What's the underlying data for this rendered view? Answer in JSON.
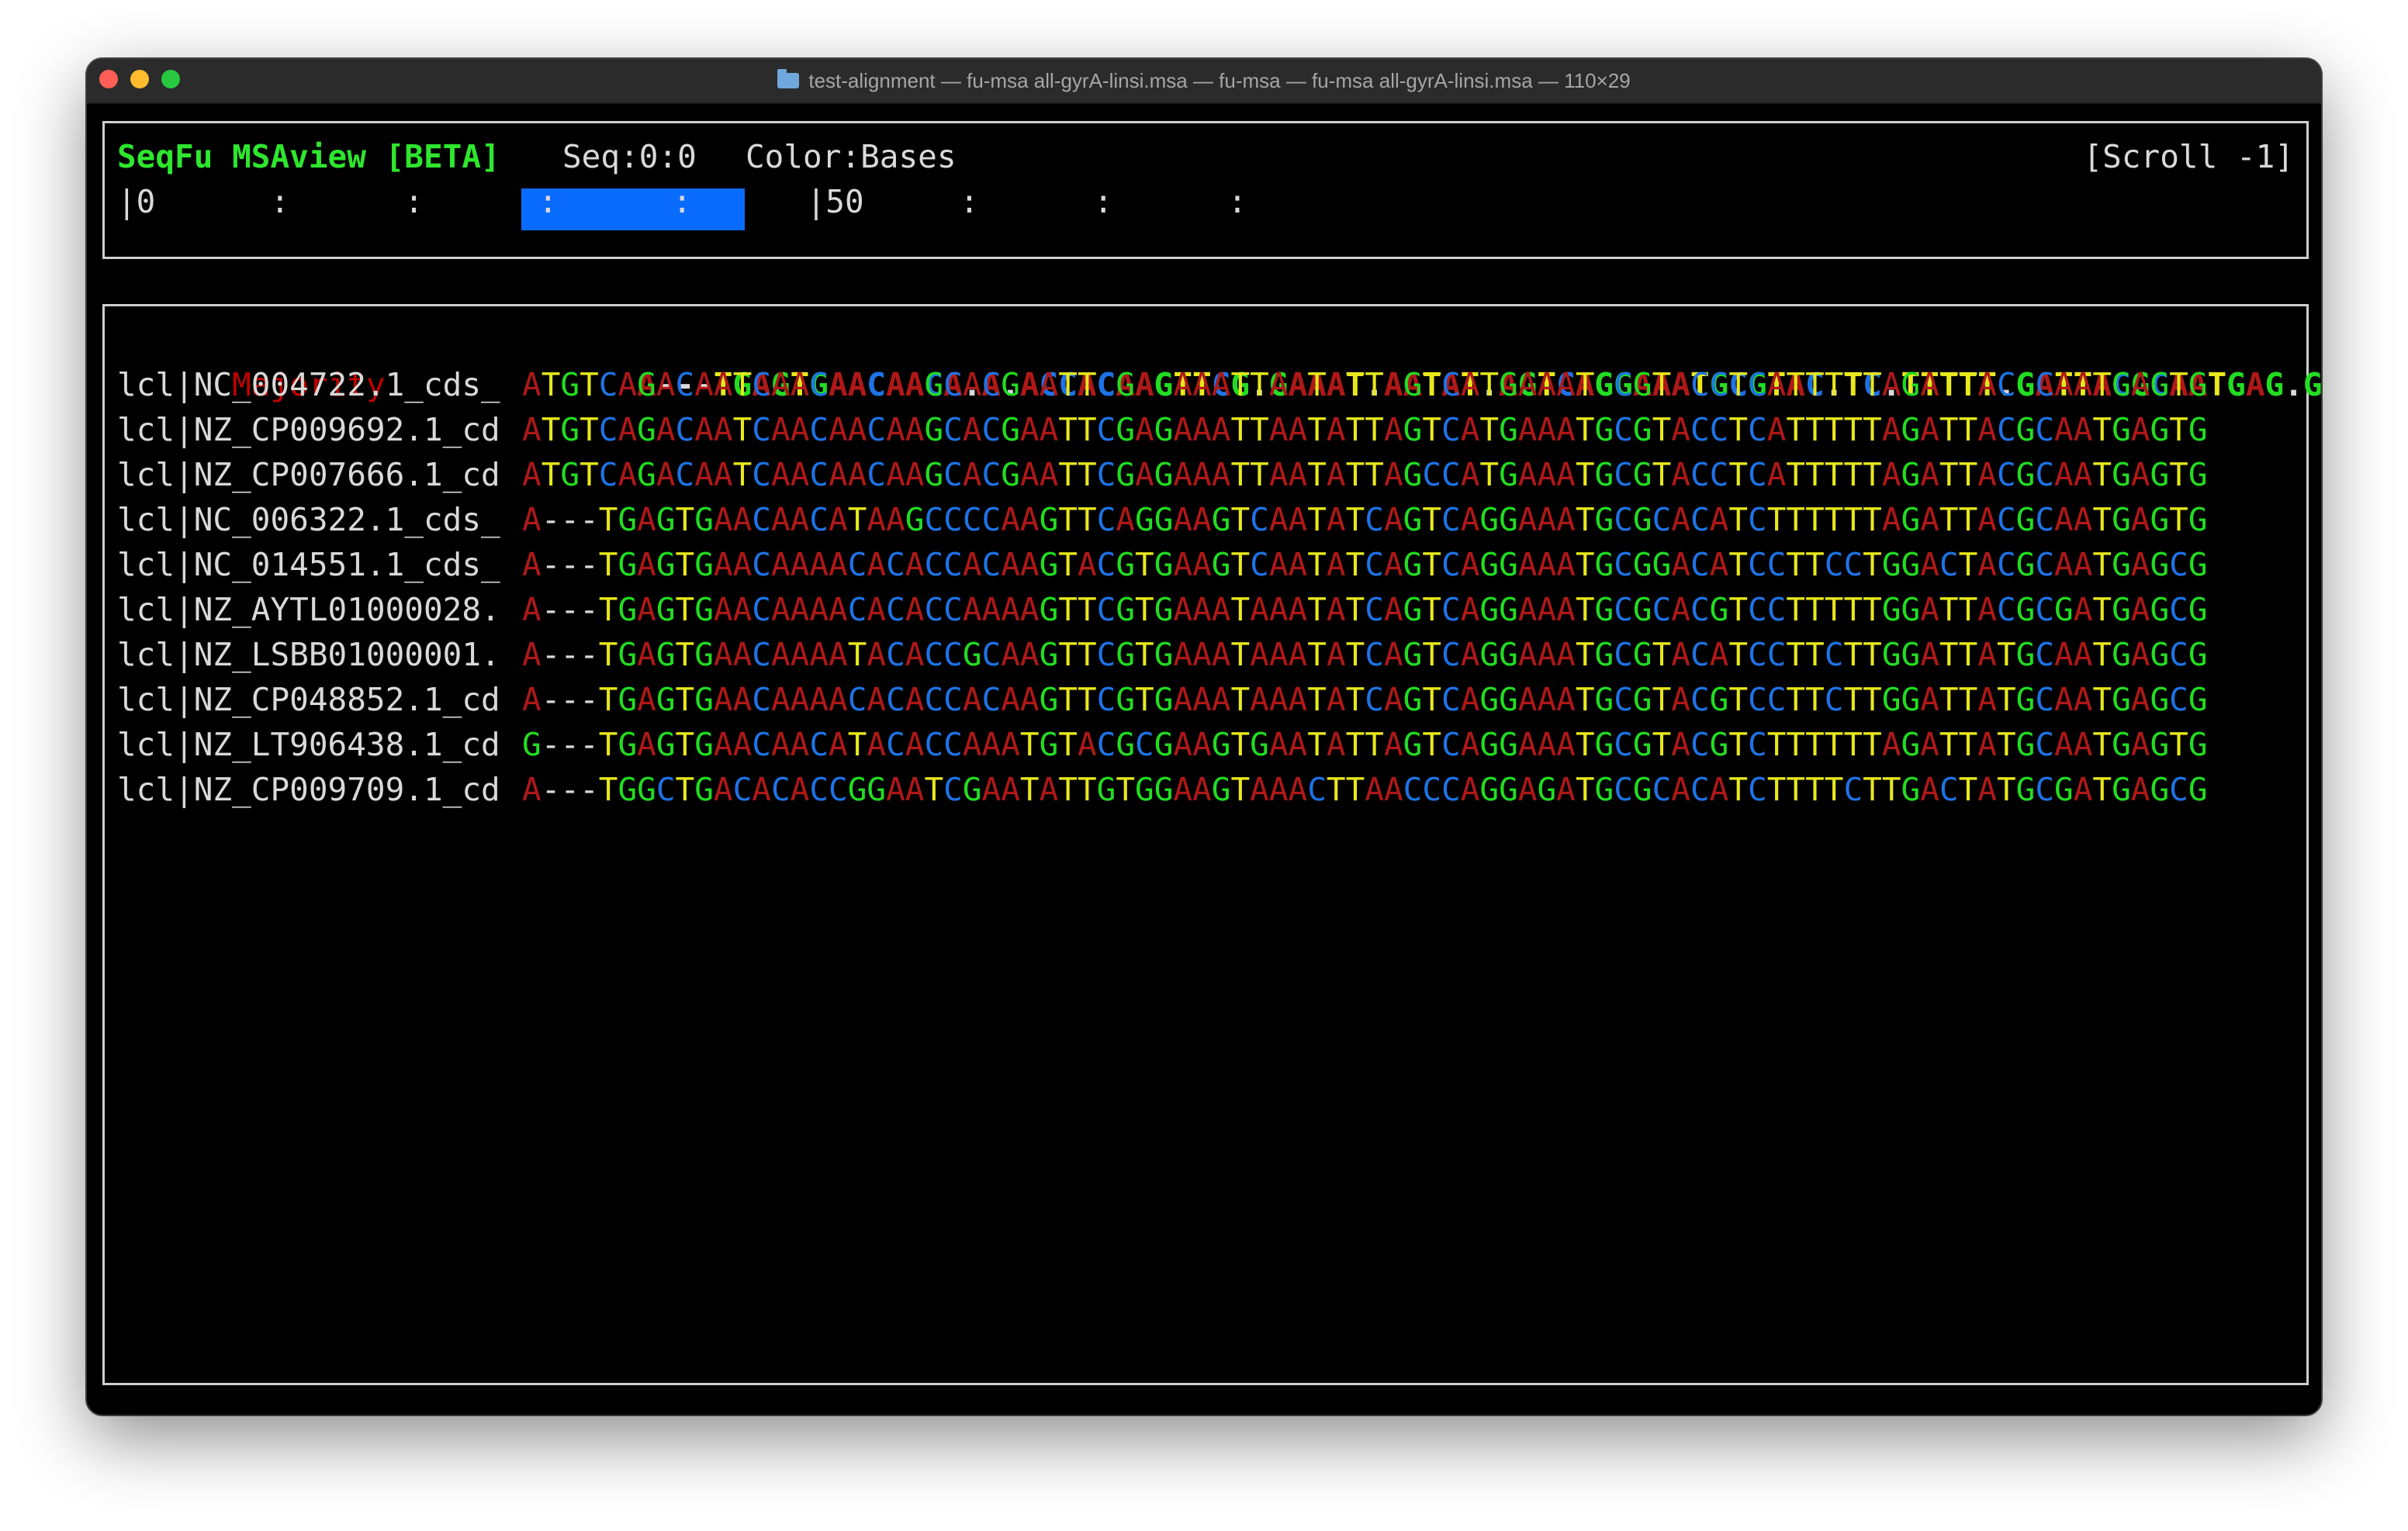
{
  "window": {
    "title": "test-alignment — fu-msa all-gyrA-linsi.msa — fu-msa — fu-msa all-gyrA-linsi.msa — 110×29"
  },
  "header": {
    "app_title": "SeqFu MSAview [BETA]",
    "seq_status": "Seq:0:0",
    "color_status": "Color:Bases",
    "scroll_status": "[Scroll -1]",
    "ruler_text": "|0      :      :      :      :      |50     :      :      :      ",
    "ruler_highlight_columns": 11
  },
  "colors": {
    "A": "#b01818",
    "C": "#1e73e6",
    "G": "#22dd22",
    "T": "#e8e81c",
    "gap": "#d9d9d9",
    "majority_label": "#c00000",
    "app_title": "#2ee62e",
    "ruler_highlight": "#0a6cff"
  },
  "majority": {
    "label": "Majority",
    "sequence": "A---TGAGTGAACAACA.A.ACCACAAGTTCG.GAAAT.AATAT.AGTCAGGAAATGCGTAC.TC.TTTTT.GATTACGCAATGAG.G"
  },
  "rows": [
    {
      "label": "lcl|NC_004722.1_cds_",
      "sequence": "ATGTCAGACAATCAACAACAAGCACGAATTCGAGAAATTAATATTAGTCATGAAATGCGTACCTCATTTTTAGATTACGCAATGAGTG"
    },
    {
      "label": "lcl|NZ_CP009692.1_cd",
      "sequence": "ATGTCAGACAATCAACAACAAGCACGAATTCGAGAAATTAATATTAGTCATGAAATGCGTACCTCATTTTTAGATTACGCAATGAGTG"
    },
    {
      "label": "lcl|NZ_CP007666.1_cd",
      "sequence": "ATGTCAGACAATCAACAACAAGCACGAATTCGAGAAATTAATATTAGCCATGAAATGCGTACCTCATTTTTAGATTACGCAATGAGTG"
    },
    {
      "label": "lcl|NC_006322.1_cds_",
      "sequence": "A---TGAGTGAACAACATAAGCCCCAAGTTCAGGAAGTCAATATCAGTCAGGAAATGCGCACATCTTTTTTAGATTACGCAATGAGTG"
    },
    {
      "label": "lcl|NC_014551.1_cds_",
      "sequence": "A---TGAGTGAACAAAACACACCACAAGTACGTGAAGTCAATATCAGTCAGGAAATGCGGACATCCTTCCTGGACTACGCAATGAGCG"
    },
    {
      "label": "lcl|NZ_AYTL01000028.",
      "sequence": "A---TGAGTGAACAAAACACACCAAAAGTTCGTGAAATAAATATCAGTCAGGAAATGCGCACGTCCTTTTTGGATTACGCGATGAGCG"
    },
    {
      "label": "lcl|NZ_LSBB01000001.",
      "sequence": "A---TGAGTGAACAAAATACACCGCAAGTTCGTGAAATAAATATCAGTCAGGAAATGCGTACATCCTTCTTGGATTATGCAATGAGCG"
    },
    {
      "label": "lcl|NZ_CP048852.1_cd",
      "sequence": "A---TGAGTGAACAAAACACACCACAAGTTCGTGAAATAAATATCAGTCAGGAAATGCGTACGTCCTTCTTGGATTATGCAATGAGCG"
    },
    {
      "label": "lcl|NZ_LT906438.1_cd",
      "sequence": "G---TGAGTGAACAACATACACCAAATGTACGCGAAGTGAATATTAGTCAGGAAATGCGTACGTCTTTTTTAGATTATGCAATGAGTG"
    },
    {
      "label": "lcl|NZ_CP009709.1_cd",
      "sequence": "A---TGGCTGACACACCGGAATCGAATATTGTGGAAGTAAACTTAACCCAGGAGATGCGCACATCTTTTCTTGACTATGCGATGAGCG"
    }
  ]
}
